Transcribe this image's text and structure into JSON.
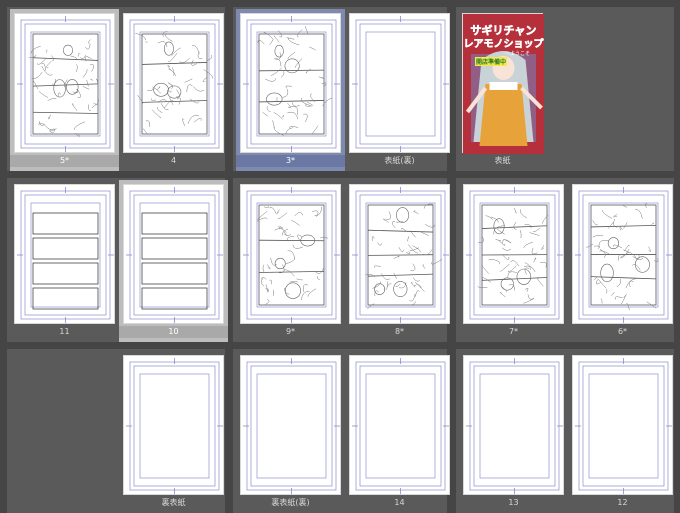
{
  "app": {
    "view": "Page Manager"
  },
  "rows": [
    {
      "spreads": [
        {
          "pages": [
            {
              "label": "5*",
              "kind": "sketch",
              "state": "selected"
            },
            {
              "label": "4",
              "kind": "sketch",
              "state": "normal"
            }
          ]
        },
        {
          "pages": [
            {
              "label": "3*",
              "kind": "sketch",
              "state": "active"
            },
            {
              "label": "表紙(裏)",
              "kind": "frame",
              "state": "normal"
            }
          ]
        },
        {
          "pages": [
            {
              "label": "表紙",
              "kind": "cover",
              "state": "normal"
            }
          ]
        }
      ]
    },
    {
      "spreads": [
        {
          "pages": [
            {
              "label": "11",
              "kind": "panels",
              "state": "normal"
            },
            {
              "label": "10",
              "kind": "panels",
              "state": "selected"
            }
          ]
        },
        {
          "pages": [
            {
              "label": "9*",
              "kind": "sketch",
              "state": "normal"
            },
            {
              "label": "8*",
              "kind": "sketch",
              "state": "normal"
            }
          ]
        },
        {
          "pages": [
            {
              "label": "7*",
              "kind": "sketch",
              "state": "normal"
            },
            {
              "label": "6*",
              "kind": "sketch",
              "state": "normal"
            }
          ]
        }
      ]
    },
    {
      "spreads": [
        {
          "pages": [
            {
              "label": "裏表紙",
              "kind": "frame",
              "state": "normal"
            }
          ]
        },
        {
          "pages": [
            {
              "label": "裏表紙(裏)",
              "kind": "frame",
              "state": "normal"
            },
            {
              "label": "14",
              "kind": "frame",
              "state": "normal"
            }
          ]
        },
        {
          "pages": [
            {
              "label": "13",
              "kind": "frame",
              "state": "normal"
            },
            {
              "label": "12",
              "kind": "frame",
              "state": "normal"
            }
          ]
        }
      ]
    }
  ],
  "cover": {
    "title_line1": "サギリチャン",
    "title_line2": "レアモノショップ",
    "subtitle": "へようこそ",
    "badge": "開店準備中",
    "colors": {
      "bg": "#b5303a",
      "title": "#2a7fd6",
      "badge": "#f3e94a",
      "apron": "#e8a23a",
      "hair": "#c9d2d6"
    }
  }
}
